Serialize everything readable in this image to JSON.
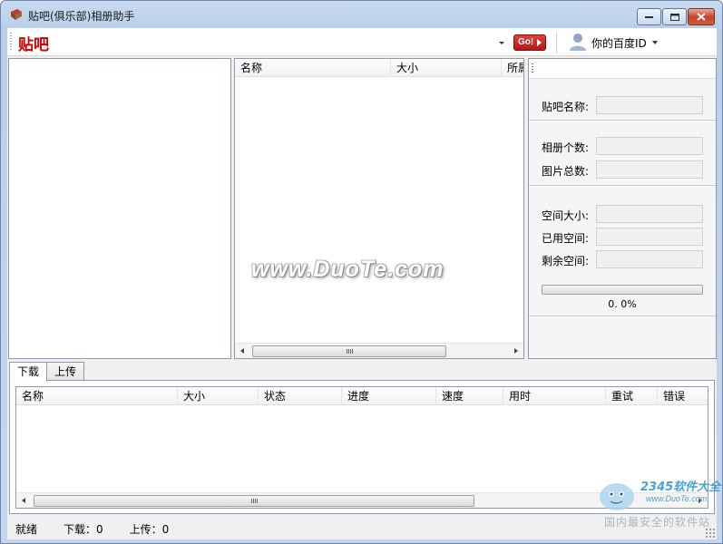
{
  "window": {
    "title": "贴吧(俱乐部)相册助手"
  },
  "toolbar": {
    "logo_text": "贴吧",
    "go_label": "Go!",
    "user_label": "你的百度ID"
  },
  "album_list": {
    "columns": [
      "名称",
      "大小",
      "所属"
    ]
  },
  "info_panel": {
    "tieba_name_label": "贴吧名称:",
    "album_count_label": "相册个数:",
    "photo_total_label": "图片总数:",
    "space_size_label": "空间大小:",
    "used_space_label": "已用空间:",
    "free_space_label": "剩余空间:",
    "progress_text": "0. 0%",
    "progress_value": 0.0
  },
  "tabs": {
    "download": "下载",
    "upload": "上传"
  },
  "task_list": {
    "columns": [
      "名称",
      "大小",
      "状态",
      "进度",
      "速度",
      "用时",
      "重试",
      "错误"
    ]
  },
  "status": {
    "ready": "就绪",
    "download": "下载：0",
    "upload": "上传：0"
  },
  "watermarks": {
    "center": "www.DuoTe.com",
    "brand": "2345软件大全",
    "url": "www.DuoTe.com",
    "slogan": "国内最安全的软件站"
  }
}
